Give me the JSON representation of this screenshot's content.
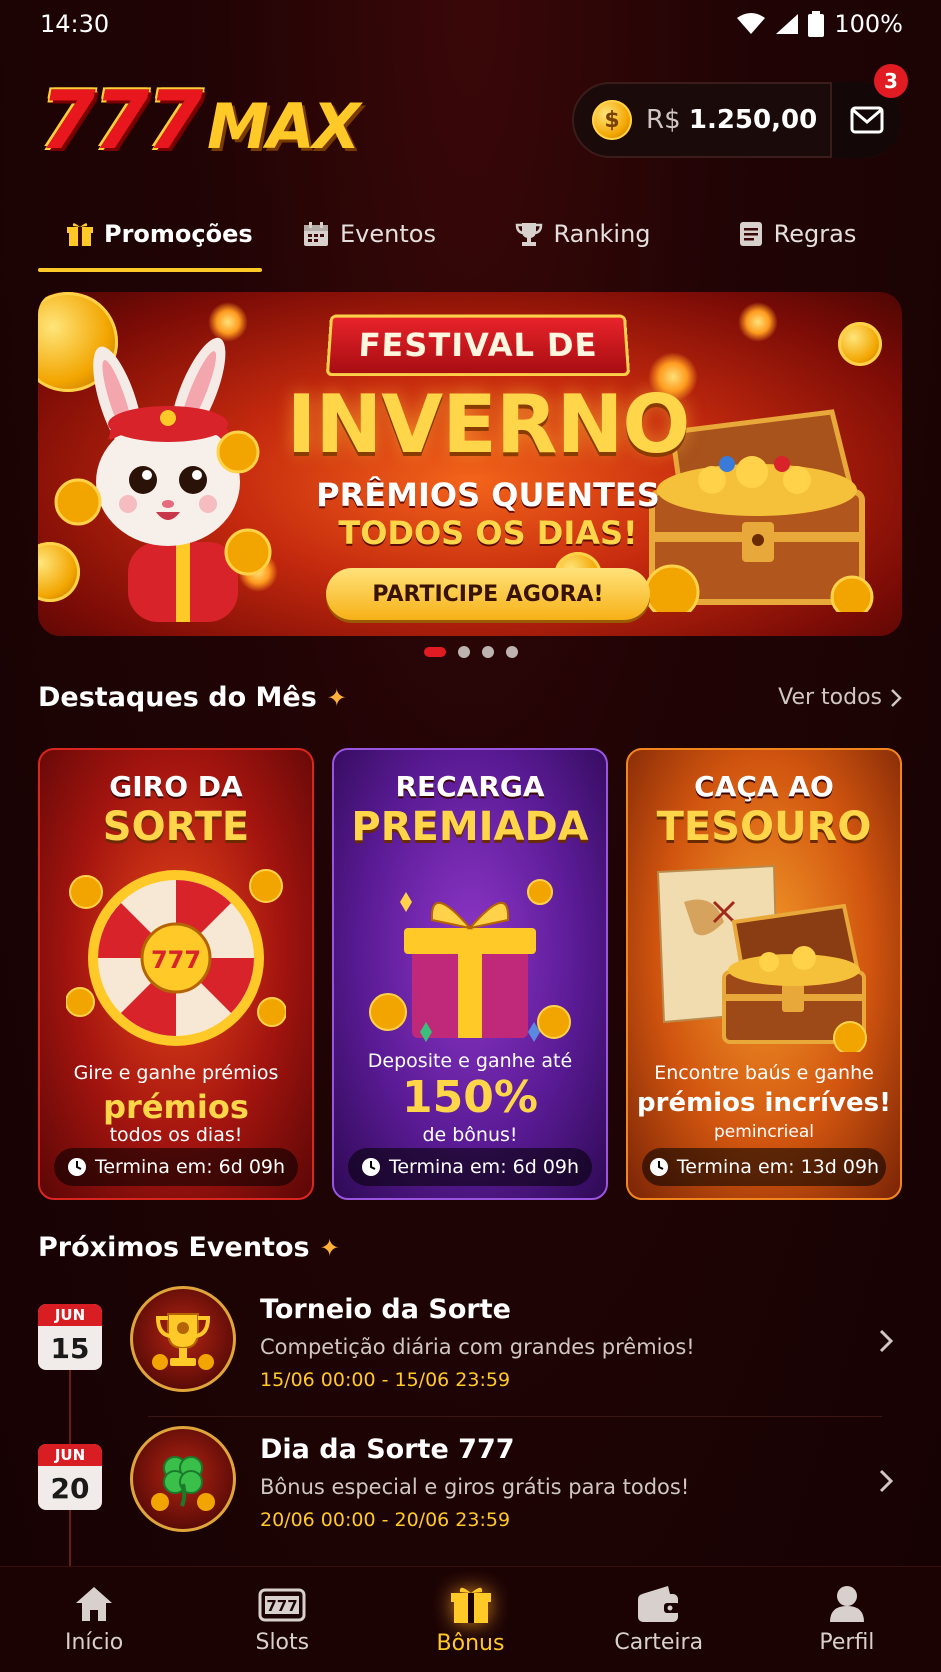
{
  "status": {
    "time": "14:30",
    "battery": "100%"
  },
  "header": {
    "logo_a": "777",
    "logo_b": "MAX",
    "currency": "R$",
    "balance": "1.250,00",
    "mail_count": "3"
  },
  "tabs": [
    {
      "label": "Promoções",
      "icon": "gift-icon"
    },
    {
      "label": "Eventos",
      "icon": "calendar-icon"
    },
    {
      "label": "Ranking",
      "icon": "trophy-icon"
    },
    {
      "label": "Regras",
      "icon": "document-icon"
    }
  ],
  "banner": {
    "ribbon": "FESTIVAL DE",
    "title": "INVERNO",
    "line1": "PRÊMIOS QUENTES",
    "line2": "TODOS OS DIAS!",
    "cta": "PARTICIPE AGORA!",
    "page_count": 4,
    "active_page": 1
  },
  "highlights": {
    "title": "Destaques do Mês",
    "see_all": "Ver todos",
    "cards": [
      {
        "t1": "GIRO DA",
        "t2": "SORTE",
        "d1": "Gire e ganhe prémios",
        "d2": "prémios",
        "d3": "todos os dias!",
        "art_label": "777",
        "timer": "Termina em: 6d 09h"
      },
      {
        "t1": "RECARGA",
        "t2": "PREMIADA",
        "d1": "Deposite e ganhe até",
        "d2": "150%",
        "d3": "de bônus!",
        "timer": "Termina em: 6d 09h"
      },
      {
        "t1": "CAÇA AO",
        "t2": "TESOURO",
        "d1": "Encontre baús e ganhe",
        "d2": "prémios incríves!",
        "d3": "pemincrieal",
        "timer": "Termina em: 13d 09h"
      }
    ]
  },
  "events": {
    "title": "Próximos Eventos",
    "items": [
      {
        "month": "JUN",
        "day": "15",
        "title": "Torneio da Sorte",
        "desc": "Competição diária com grandes prêmios!",
        "dates": "15/06 00:00 - 15/06 23:59",
        "icon": "trophy-icon"
      },
      {
        "month": "JUN",
        "day": "20",
        "title": "Dia da Sorte 777",
        "desc": "Bônus especial e giros grátis para todos!",
        "dates": "20/06 00:00 - 20/06 23:59",
        "icon": "clover-icon"
      }
    ]
  },
  "nav": [
    {
      "label": "Início",
      "icon": "home-icon"
    },
    {
      "label": "Slots",
      "icon": "slot-machine-icon"
    },
    {
      "label": "Bônus",
      "icon": "gift-icon",
      "active": true
    },
    {
      "label": "Carteira",
      "icon": "wallet-icon"
    },
    {
      "label": "Perfil",
      "icon": "user-icon"
    }
  ],
  "colors": {
    "accent": "#ffc928",
    "brand_red": "#e11b22",
    "bg": "#1b0304"
  }
}
